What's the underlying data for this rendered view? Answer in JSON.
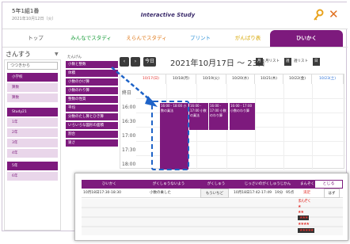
{
  "header": {
    "title": "5年1組1番",
    "date": "2021年10月12日（火）",
    "logo": "Interactive Study"
  },
  "nav": {
    "tabs": [
      {
        "label": "トップ",
        "color": "#555555"
      },
      {
        "label": "みんなでスタディ",
        "color": "#1a9d3b"
      },
      {
        "label": "えらんでスタディ",
        "color": "#e07c1f"
      },
      {
        "label": "プリント",
        "color": "#2a8fd6"
      },
      {
        "label": "がんばり表",
        "color": "#d6a600"
      },
      {
        "label": "ひいかく",
        "color": "#ffffff"
      }
    ]
  },
  "sidebar": {
    "subject": "さんすう",
    "all_label": "つつきから",
    "items": [
      {
        "label": "小学校",
        "style": "dark"
      },
      {
        "label": "算数",
        "style": "light"
      },
      {
        "label": "算数",
        "style": "light"
      },
      {
        "label": "Study21",
        "style": "dark"
      },
      {
        "label": "1年",
        "style": "light"
      },
      {
        "label": "2年",
        "style": "light"
      },
      {
        "label": "3年",
        "style": "light"
      },
      {
        "label": "4年",
        "style": "light"
      },
      {
        "label": "5年",
        "style": "dark"
      },
      {
        "label": "6年",
        "style": "light"
      }
    ]
  },
  "units": {
    "label": "たんげん",
    "items": [
      "小数と整数",
      "体積",
      "小数のかけ算",
      "小数のわり算",
      "整数の性質",
      "平均",
      "分数のたし算とひき算",
      "いろいろな図形の面積",
      "割合",
      "速さ"
    ]
  },
  "calendar": {
    "prev": "‹",
    "next": "›",
    "today": "今日",
    "title": "2021年10月17日 ～ 23日",
    "view_month": "月",
    "view_list": "月リスト",
    "view_week": "週",
    "view_week_list": "週リスト",
    "view_day": "日",
    "days": [
      "10/17(日)",
      "10/18(月)",
      "10/19(火)",
      "10/20(水)",
      "10/21(木)",
      "10/22(金)",
      "10/23(土)"
    ],
    "times": [
      "終日",
      "16:00",
      "16:30",
      "17:00",
      "17:30",
      "18:00"
    ],
    "events": [
      {
        "text": "16:00 - 18:00 小数の乗法"
      },
      {
        "text": "16:00 - 17:00 小数の乗法"
      },
      {
        "text": "16:00 - 17:00 小数のわり算"
      },
      {
        "text": "16:00 - 17:00 小数のわり算"
      }
    ]
  },
  "popup": {
    "headers": [
      "ひいかく",
      "がくしゅうないよう",
      "がくしゅう",
      "じっさいのがくしゅうじかん",
      "まんぞく",
      "とじる"
    ],
    "row": {
      "plan_time": "10月18日17:30-18:30",
      "content": "小数の乗した",
      "action": "もういちど",
      "actual_time": "10月18日17:42-17:49",
      "minutes": "19分",
      "score": "95点",
      "mark": "満足",
      "other": "はず"
    },
    "stars_label": "まんぞく"
  }
}
